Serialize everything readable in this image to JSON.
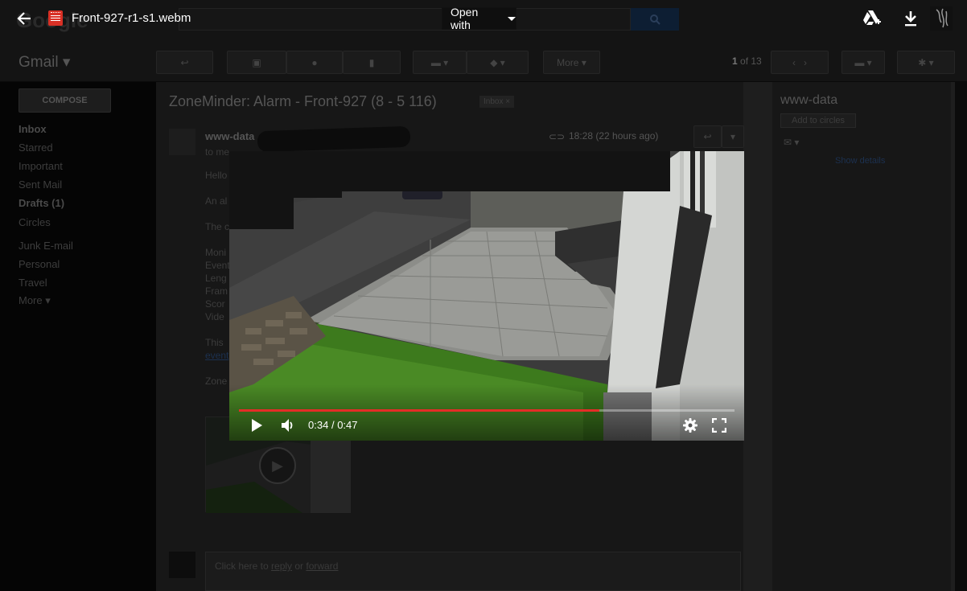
{
  "viewer": {
    "file_name": "Front-927-r1-s1.webm",
    "open_with_label": "Open with",
    "icons": [
      "back-arrow-icon",
      "video-file-icon",
      "add-to-drive-icon",
      "download-icon",
      "account-avatar-icon"
    ]
  },
  "player": {
    "current_time": "0:34",
    "separator": "/",
    "duration": "0:47",
    "progress": 0.727,
    "icons": [
      "play-icon",
      "volume-icon",
      "settings-icon",
      "fullscreen-icon"
    ],
    "accent_color": "#e52d27"
  },
  "gmail": {
    "brand": "Gmail",
    "compose_label": "COMPOSE",
    "nav": [
      {
        "label": "Inbox",
        "bold": true
      },
      {
        "label": "Starred"
      },
      {
        "label": "Important"
      },
      {
        "label": "Sent Mail"
      },
      {
        "label": "Drafts (1)",
        "bold": true
      },
      {
        "label": "Circles"
      },
      {
        "label": "Junk E-mail"
      },
      {
        "label": "Personal"
      },
      {
        "label": "Travel"
      },
      {
        "label": "More"
      }
    ],
    "toolbar": {
      "more_label": "More",
      "pager_current": "1",
      "pager_of": "of 13"
    },
    "email": {
      "subject": "ZoneMinder: Alarm - Front-927 (8 - 5 116)",
      "label": "Inbox",
      "sender": "www-data",
      "to": "to me",
      "time": "18:28 (22 hours ago)",
      "body_lines": [
        "Hello",
        "An al",
        "The c",
        "Moni",
        "Event",
        "Leng",
        "Fram",
        "Scor",
        "Vide",
        "This",
        "event",
        "Zone"
      ]
    },
    "reply": {
      "prefix": "Click here to ",
      "reply": "reply",
      "middle": " or ",
      "forward": "forward"
    },
    "right_panel": {
      "name": "www-data",
      "add_to_circles": "Add to circles",
      "show_details": "Show details"
    }
  }
}
